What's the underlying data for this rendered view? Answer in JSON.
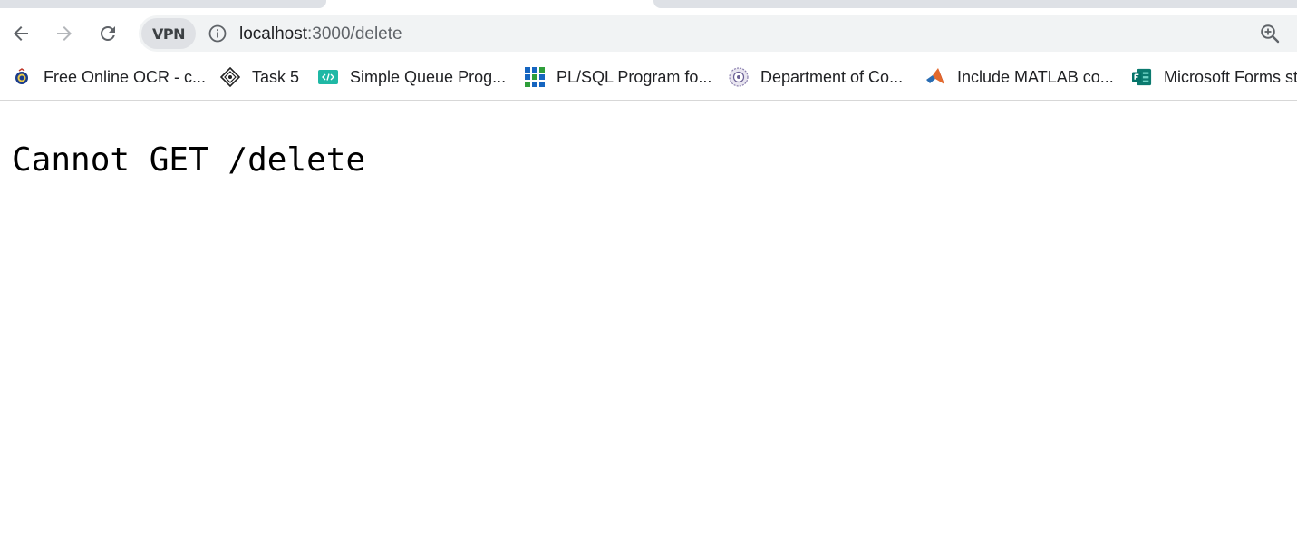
{
  "browser": {
    "url": {
      "host": "localhost",
      "path": ":3000/delete"
    },
    "vpn_label": "VPN",
    "bookmarks": [
      {
        "label": "Free Online OCR - c...",
        "icon": "ocr-globe-icon"
      },
      {
        "label": "Task 5",
        "icon": "diamond-logo-icon"
      },
      {
        "label": "Simple Queue Prog...",
        "icon": "code-brackets-icon"
      },
      {
        "label": "PL/SQL Program fo...",
        "icon": "grid-blocks-icon"
      },
      {
        "label": "Department of Co...",
        "icon": "emblem-seal-icon"
      },
      {
        "label": "Include MATLAB co...",
        "icon": "matlab-logo-icon"
      },
      {
        "label": "Microsoft Forms st",
        "icon": "microsoft-forms-icon"
      }
    ]
  },
  "page": {
    "error_text": "Cannot GET /delete"
  },
  "colors": {
    "omnibox_bg": "#f1f3f4",
    "tab_inactive": "#dee1e6",
    "text": "#202124",
    "muted": "#5f6368"
  }
}
